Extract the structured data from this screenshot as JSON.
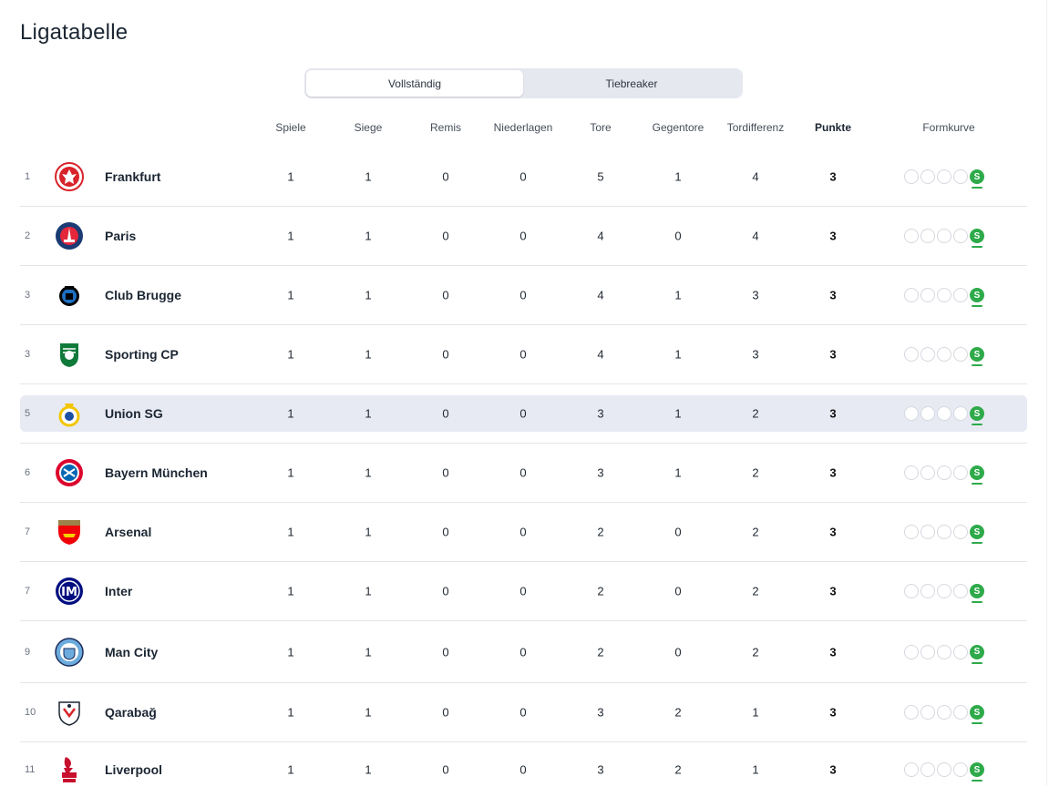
{
  "page": {
    "title": "Ligatabelle"
  },
  "tabs": [
    {
      "label": "Vollständig",
      "active": true
    },
    {
      "label": "Tiebreaker",
      "active": false
    }
  ],
  "columns": {
    "played": "Spiele",
    "won": "Siege",
    "drawn": "Remis",
    "lost": "Niederlagen",
    "goals_for": "Tore",
    "goals_against": "Gegentore",
    "goal_diff": "Tordifferenz",
    "points": "Punkte",
    "form": "Formkurve"
  },
  "colors": {
    "win": "#2eaa4a",
    "highlight_row": "#e8eaf3",
    "segment_bg": "#e6e8f0"
  },
  "form_win_label": "S",
  "rows": [
    {
      "rank": "1",
      "team": "Frankfurt",
      "crest": "frankfurt-crest-icon",
      "played": "1",
      "won": "1",
      "drawn": "0",
      "lost": "0",
      "gf": "5",
      "ga": "1",
      "gd": "4",
      "pts": "3",
      "highlight": false
    },
    {
      "rank": "2",
      "team": "Paris",
      "crest": "paris-crest-icon",
      "played": "1",
      "won": "1",
      "drawn": "0",
      "lost": "0",
      "gf": "4",
      "ga": "0",
      "gd": "4",
      "pts": "3",
      "highlight": false
    },
    {
      "rank": "3",
      "team": "Club Brugge",
      "crest": "brugge-crest-icon",
      "played": "1",
      "won": "1",
      "drawn": "0",
      "lost": "0",
      "gf": "4",
      "ga": "1",
      "gd": "3",
      "pts": "3",
      "highlight": false
    },
    {
      "rank": "3",
      "team": "Sporting CP",
      "crest": "sporting-crest-icon",
      "played": "1",
      "won": "1",
      "drawn": "0",
      "lost": "0",
      "gf": "4",
      "ga": "1",
      "gd": "3",
      "pts": "3",
      "highlight": false
    },
    {
      "rank": "5",
      "team": "Union SG",
      "crest": "union-crest-icon",
      "played": "1",
      "won": "1",
      "drawn": "0",
      "lost": "0",
      "gf": "3",
      "ga": "1",
      "gd": "2",
      "pts": "3",
      "highlight": true
    },
    {
      "rank": "6",
      "team": "Bayern München",
      "crest": "bayern-crest-icon",
      "played": "1",
      "won": "1",
      "drawn": "0",
      "lost": "0",
      "gf": "3",
      "ga": "1",
      "gd": "2",
      "pts": "3",
      "highlight": false
    },
    {
      "rank": "7",
      "team": "Arsenal",
      "crest": "arsenal-crest-icon",
      "played": "1",
      "won": "1",
      "drawn": "0",
      "lost": "0",
      "gf": "2",
      "ga": "0",
      "gd": "2",
      "pts": "3",
      "highlight": false
    },
    {
      "rank": "7",
      "team": "Inter",
      "crest": "inter-crest-icon",
      "played": "1",
      "won": "1",
      "drawn": "0",
      "lost": "0",
      "gf": "2",
      "ga": "0",
      "gd": "2",
      "pts": "3",
      "highlight": false
    },
    {
      "rank": "9",
      "team": "Man City",
      "crest": "mancity-crest-icon",
      "played": "1",
      "won": "1",
      "drawn": "0",
      "lost": "0",
      "gf": "2",
      "ga": "0",
      "gd": "2",
      "pts": "3",
      "highlight": false
    },
    {
      "rank": "10",
      "team": "Qarabağ",
      "crest": "qarabag-crest-icon",
      "played": "1",
      "won": "1",
      "drawn": "0",
      "lost": "0",
      "gf": "3",
      "ga": "2",
      "gd": "1",
      "pts": "3",
      "highlight": false
    },
    {
      "rank": "11",
      "team": "Liverpool",
      "crest": "liverpool-crest-icon",
      "played": "1",
      "won": "1",
      "drawn": "0",
      "lost": "0",
      "gf": "3",
      "ga": "2",
      "gd": "1",
      "pts": "3",
      "highlight": false
    }
  ]
}
